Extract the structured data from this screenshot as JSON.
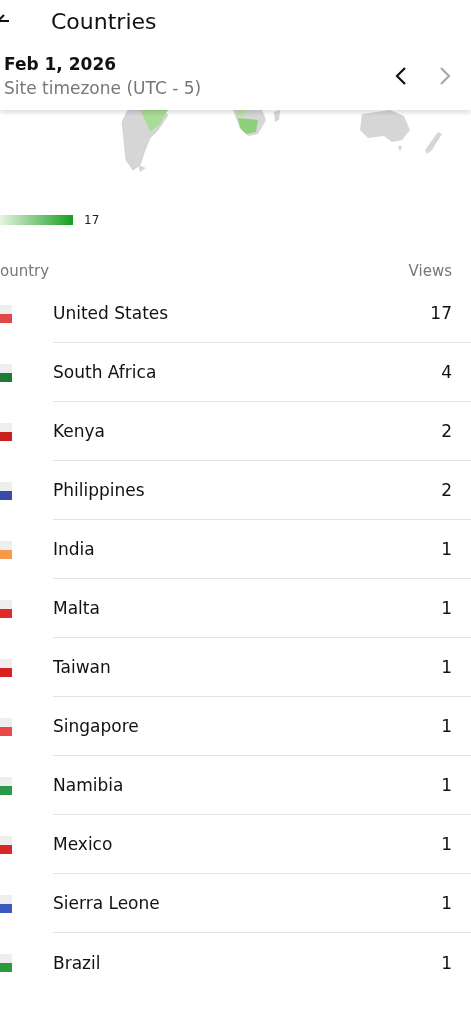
{
  "app_bar": {
    "title": "Countries"
  },
  "date_card": {
    "date": "Feb 1, 2026",
    "timezone": "Site timezone (UTC - 5)",
    "prev_disabled": false,
    "next_disabled": true
  },
  "legend": {
    "max": "17"
  },
  "table": {
    "columns": [
      "ountry",
      "Views"
    ],
    "rows": [
      {
        "name": "United States",
        "views": "17",
        "color": "#e04848"
      },
      {
        "name": "South Africa",
        "views": "4",
        "color": "#1f7a3a"
      },
      {
        "name": "Kenya",
        "views": "2",
        "color": "#c82020"
      },
      {
        "name": "Philippines",
        "views": "2",
        "color": "#3a4aaa"
      },
      {
        "name": "India",
        "views": "1",
        "color": "#f49a4a"
      },
      {
        "name": "Malta",
        "views": "1",
        "color": "#e02a2a"
      },
      {
        "name": "Taiwan",
        "views": "1",
        "color": "#d82020"
      },
      {
        "name": "Singapore",
        "views": "1",
        "color": "#e84848"
      },
      {
        "name": "Namibia",
        "views": "1",
        "color": "#2a9a4a"
      },
      {
        "name": "Mexico",
        "views": "1",
        "color": "#d82828"
      },
      {
        "name": "Sierra Leone",
        "views": "1",
        "color": "#3a5ac0"
      },
      {
        "name": "Brazil",
        "views": "1",
        "color": "#2a9a3a"
      }
    ]
  }
}
